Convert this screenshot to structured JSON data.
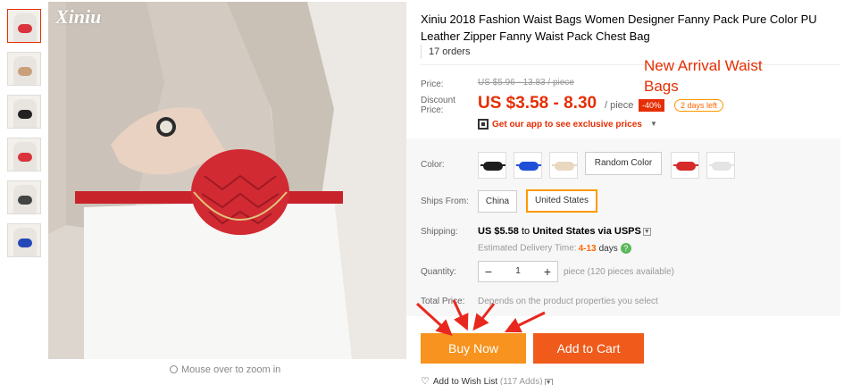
{
  "product": {
    "brand": "Xiniu",
    "title": "Xiniu 2018 Fashion Waist Bags Women Designer Fanny Pack Pure Color PU Leather Zipper Fanny Waist Pack Chest Bag",
    "orders": "17 orders"
  },
  "annotation": "New Arrival Waist Bags",
  "thumbnails": [
    {
      "name": "thumbnail-1",
      "bag_color": "#d9333b"
    },
    {
      "name": "thumbnail-2",
      "bag_color": "#c9a07a"
    },
    {
      "name": "thumbnail-3",
      "bag_color": "#222222"
    },
    {
      "name": "thumbnail-4",
      "bag_color": "#d9333b"
    },
    {
      "name": "thumbnail-5",
      "bag_color": "#444444"
    },
    {
      "name": "thumbnail-6",
      "bag_color": "#2447b8"
    }
  ],
  "zoom_hint": "Mouse over to zoom in",
  "price": {
    "price_label": "Price:",
    "old": "US $5.96 - 13.83 / piece",
    "discount_label_1": "Discount",
    "discount_label_2": "Price:",
    "current": "US $3.58 - 8.30",
    "per": "/ piece",
    "off": "-40%",
    "days_left": "2 days left",
    "app_promo": "Get our app to see exclusive prices"
  },
  "options": {
    "color_label": "Color:",
    "colors": [
      {
        "name": "black",
        "hex": "#1e1e1e"
      },
      {
        "name": "blue",
        "hex": "#1f4fd6"
      },
      {
        "name": "beige",
        "hex": "#e8d8bf"
      }
    ],
    "random_color": "Random Color",
    "colors_after": [
      {
        "name": "red",
        "hex": "#d62a2a"
      },
      {
        "name": "white",
        "hex": "#e4e4e4"
      }
    ],
    "ships_from_label": "Ships From:",
    "ships_from": [
      "China",
      "United States"
    ],
    "ships_from_selected": "United States",
    "shipping_label": "Shipping:",
    "shipping_cost": "US $5.58",
    "shipping_to": "to",
    "shipping_dest": "United States via USPS",
    "delivery_label": "Estimated Delivery Time:",
    "delivery_range": "4-13",
    "delivery_unit": "days",
    "quantity_label": "Quantity:",
    "quantity": "1",
    "minus": "−",
    "plus": "+",
    "pieces_available": "piece (120 pieces available)",
    "total_label": "Total Price:",
    "total_value": "Depends on the product properties you select"
  },
  "actions": {
    "buy_now": "Buy Now",
    "add_to_cart": "Add to Cart",
    "wish_list": "Add to Wish List",
    "wish_count": "(117 Adds)"
  },
  "colors": {
    "accent": "#e62e04",
    "buy_now": "#f7931e",
    "add_to_cart": "#f05a1a",
    "selected_border": "#ff9900",
    "arrow": "#e8281e"
  }
}
